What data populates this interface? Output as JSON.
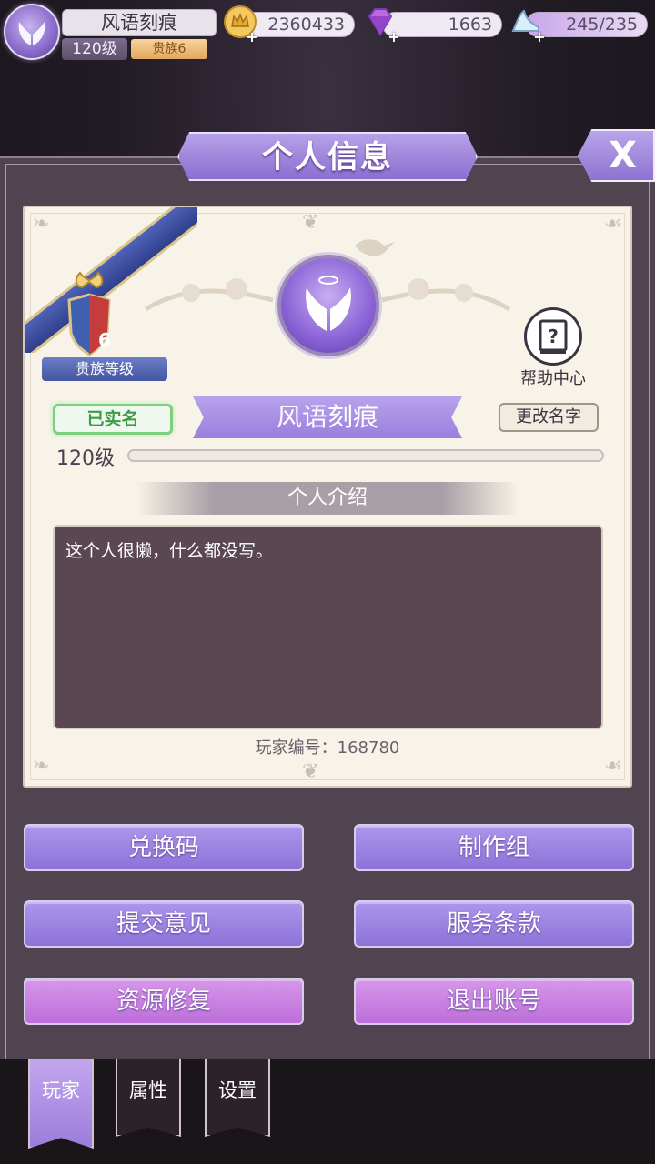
{
  "top_bar": {
    "player_name": "风语刻痕",
    "level": "120级",
    "noble_badge": "贵族6",
    "gold": "2360433",
    "gems": "1663",
    "stamina": "245/235",
    "plus_symbol": "+"
  },
  "panel": {
    "title": "个人信息",
    "close_label": "X"
  },
  "profile": {
    "noble_level_number": "6",
    "noble_level_label": "贵族等级",
    "verified_label": "已实名",
    "name": "风语刻痕",
    "rename_label": "更改名字",
    "help_label": "帮助中心",
    "level_text": "120级",
    "level_progress": 0,
    "intro_title": "个人介绍",
    "intro_text": "这个人很懒，什么都没写。",
    "player_id": "玩家编号：168780"
  },
  "buttons": {
    "redeem": "兑换码",
    "credits": "制作组",
    "feedback": "提交意见",
    "terms": "服务条款",
    "repair": "资源修复",
    "logout": "退出账号"
  },
  "tabs": {
    "player": "玩家",
    "attributes": "属性",
    "settings": "设置"
  },
  "colors": {
    "accent_purple": "#9b7ddd",
    "accent_pink": "#c97fe1",
    "verified_green": "#7ccf7f"
  }
}
